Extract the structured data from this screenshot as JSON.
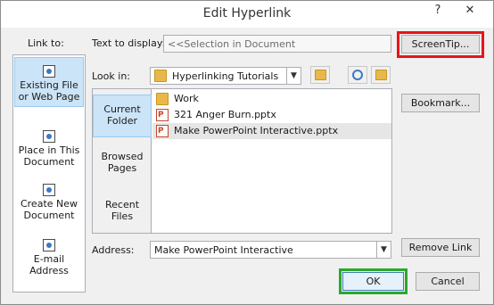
{
  "window": {
    "title": "Edit Hyperlink",
    "help_glyph": "?",
    "close_glyph": "✕"
  },
  "link_to": {
    "label": "Link to:",
    "items": [
      {
        "line1": "Existing File",
        "line2": "or Web Page",
        "icon": "globe-doc-icon",
        "selected": true
      },
      {
        "line1": "Place in This",
        "line2": "Document",
        "icon": "doc-bookmark-icon",
        "selected": false
      },
      {
        "line1": "Create New",
        "line2": "Document",
        "icon": "new-doc-icon",
        "selected": false
      },
      {
        "line1": "E-mail",
        "line2": "Address",
        "icon": "email-icon",
        "selected": false
      }
    ]
  },
  "text_to_display": {
    "label": "Text to display:",
    "value": "<<Selection in Document"
  },
  "screentip_button": "ScreenTip...",
  "look_in": {
    "label": "Look in:",
    "value": "Hyperlinking Tutorials"
  },
  "places": [
    {
      "line1": "Current",
      "line2": "Folder",
      "selected": true
    },
    {
      "line1": "Browsed",
      "line2": "Pages",
      "selected": false
    },
    {
      "line1": "Recent",
      "line2": "Files",
      "selected": false
    }
  ],
  "files": [
    {
      "name": "Work",
      "type": "folder"
    },
    {
      "name": "321 Anger Burn.pptx",
      "type": "pptx"
    },
    {
      "name": "Make PowerPoint Interactive.pptx",
      "type": "pptx",
      "selected": true
    }
  ],
  "bookmark_button": "Bookmark...",
  "address": {
    "label": "Address:",
    "value": "Make PowerPoint Interactive"
  },
  "remove_link_button": "Remove Link",
  "ok_button": "OK",
  "cancel_button": "Cancel",
  "highlights": {
    "screentip": "#e8141c",
    "ok": "#2aa92a"
  }
}
